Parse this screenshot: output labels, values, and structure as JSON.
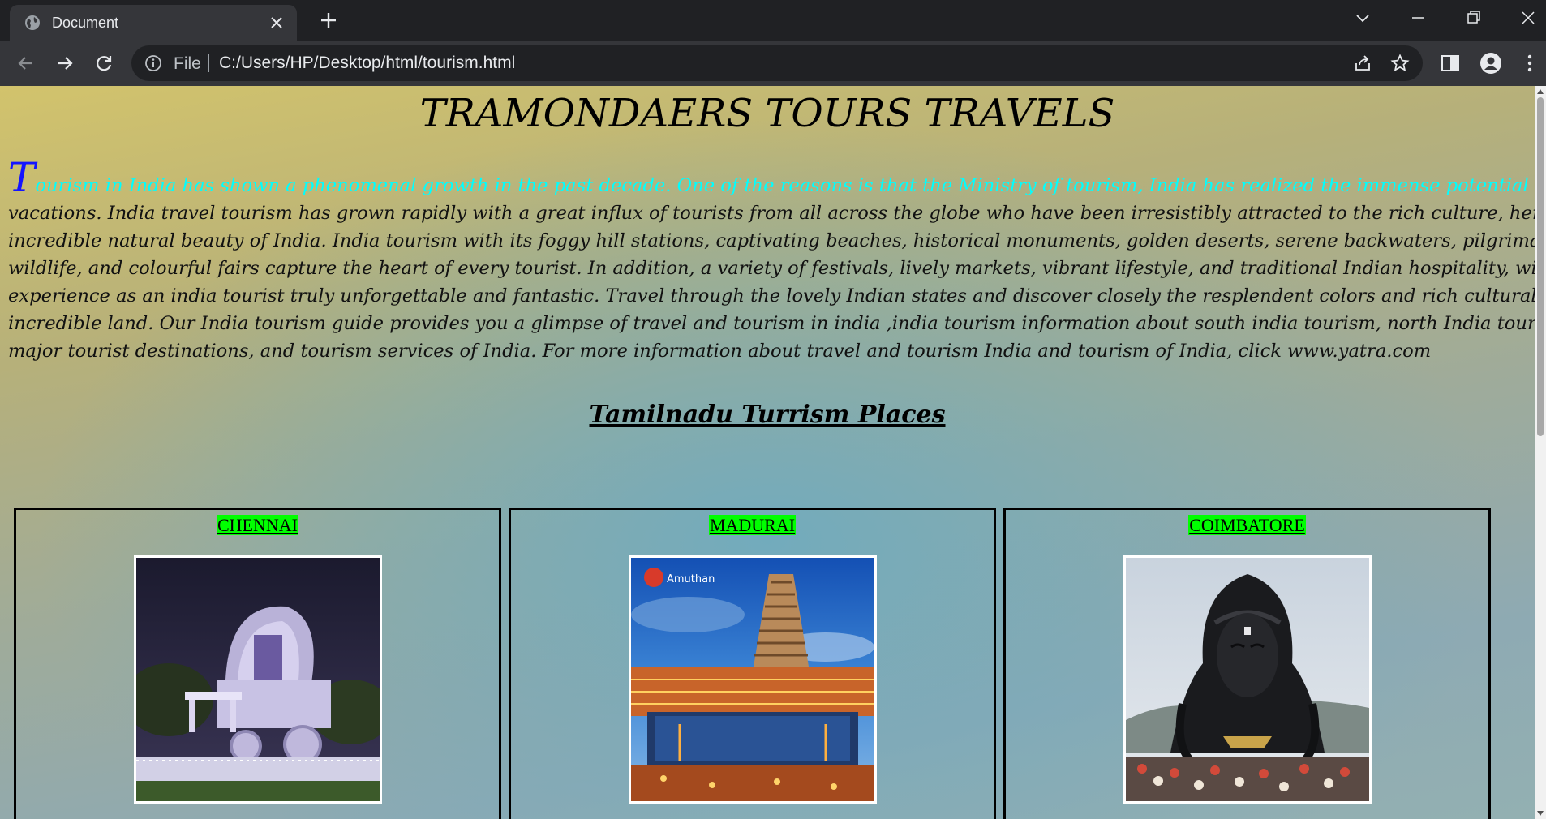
{
  "browser": {
    "tab_title": "Document",
    "file_label": "File",
    "url": "C:/Users/HP/Desktop/html/tourism.html"
  },
  "page": {
    "title": "TRAMONDAERS TOURS TRAVELS",
    "intro": {
      "drop_cap": "T",
      "highlight_text": "ourism in India has shown a phenomenal growth in the past decade. One of the reasons is that the Ministry of tourism, India has realized the immense potential of tourism in India during",
      "lines": [
        "vacations. India travel tourism has grown rapidly with a great influx of tourists from all across the globe who have been irresistibly attracted to the rich culture, heritage, and",
        "incredible natural beauty of India. India tourism with its foggy hill stations, captivating beaches, historical monuments, golden deserts, serene backwaters, pilgrimage sites, rich",
        "wildlife, and colourful fairs capture the heart of every tourist. In addition, a variety of festivals, lively markets, vibrant lifestyle, and traditional Indian hospitality, will make your",
        "experience as an india tourist truly unforgettable and fantastic. Travel through the lovely Indian states and discover closely the resplendent colors and rich cultural locales of this",
        "incredible land. Our India tourism guide provides you a glimpse of travel and tourism in india ,india tourism information about south india tourism, north India tourism, and all the",
        "major tourist destinations, and tourism services of India. For more information about travel and tourism India and tourism of India, click www.yatra.com"
      ]
    },
    "subtitle": "Tamilnadu Turrism Places",
    "places": [
      {
        "name": "CHENNAI",
        "photo_icon": "chennai-monument-photo"
      },
      {
        "name": "MADURAI",
        "photo_icon": "madurai-temple-photo",
        "watermark": "Amuthan"
      },
      {
        "name": "COIMBATORE",
        "photo_icon": "coimbatore-adiyogi-photo"
      }
    ]
  },
  "colors": {
    "highlight_text": "#00ffff",
    "drop_cap": "#1414ff",
    "place_label_bg": "#00ff00"
  }
}
